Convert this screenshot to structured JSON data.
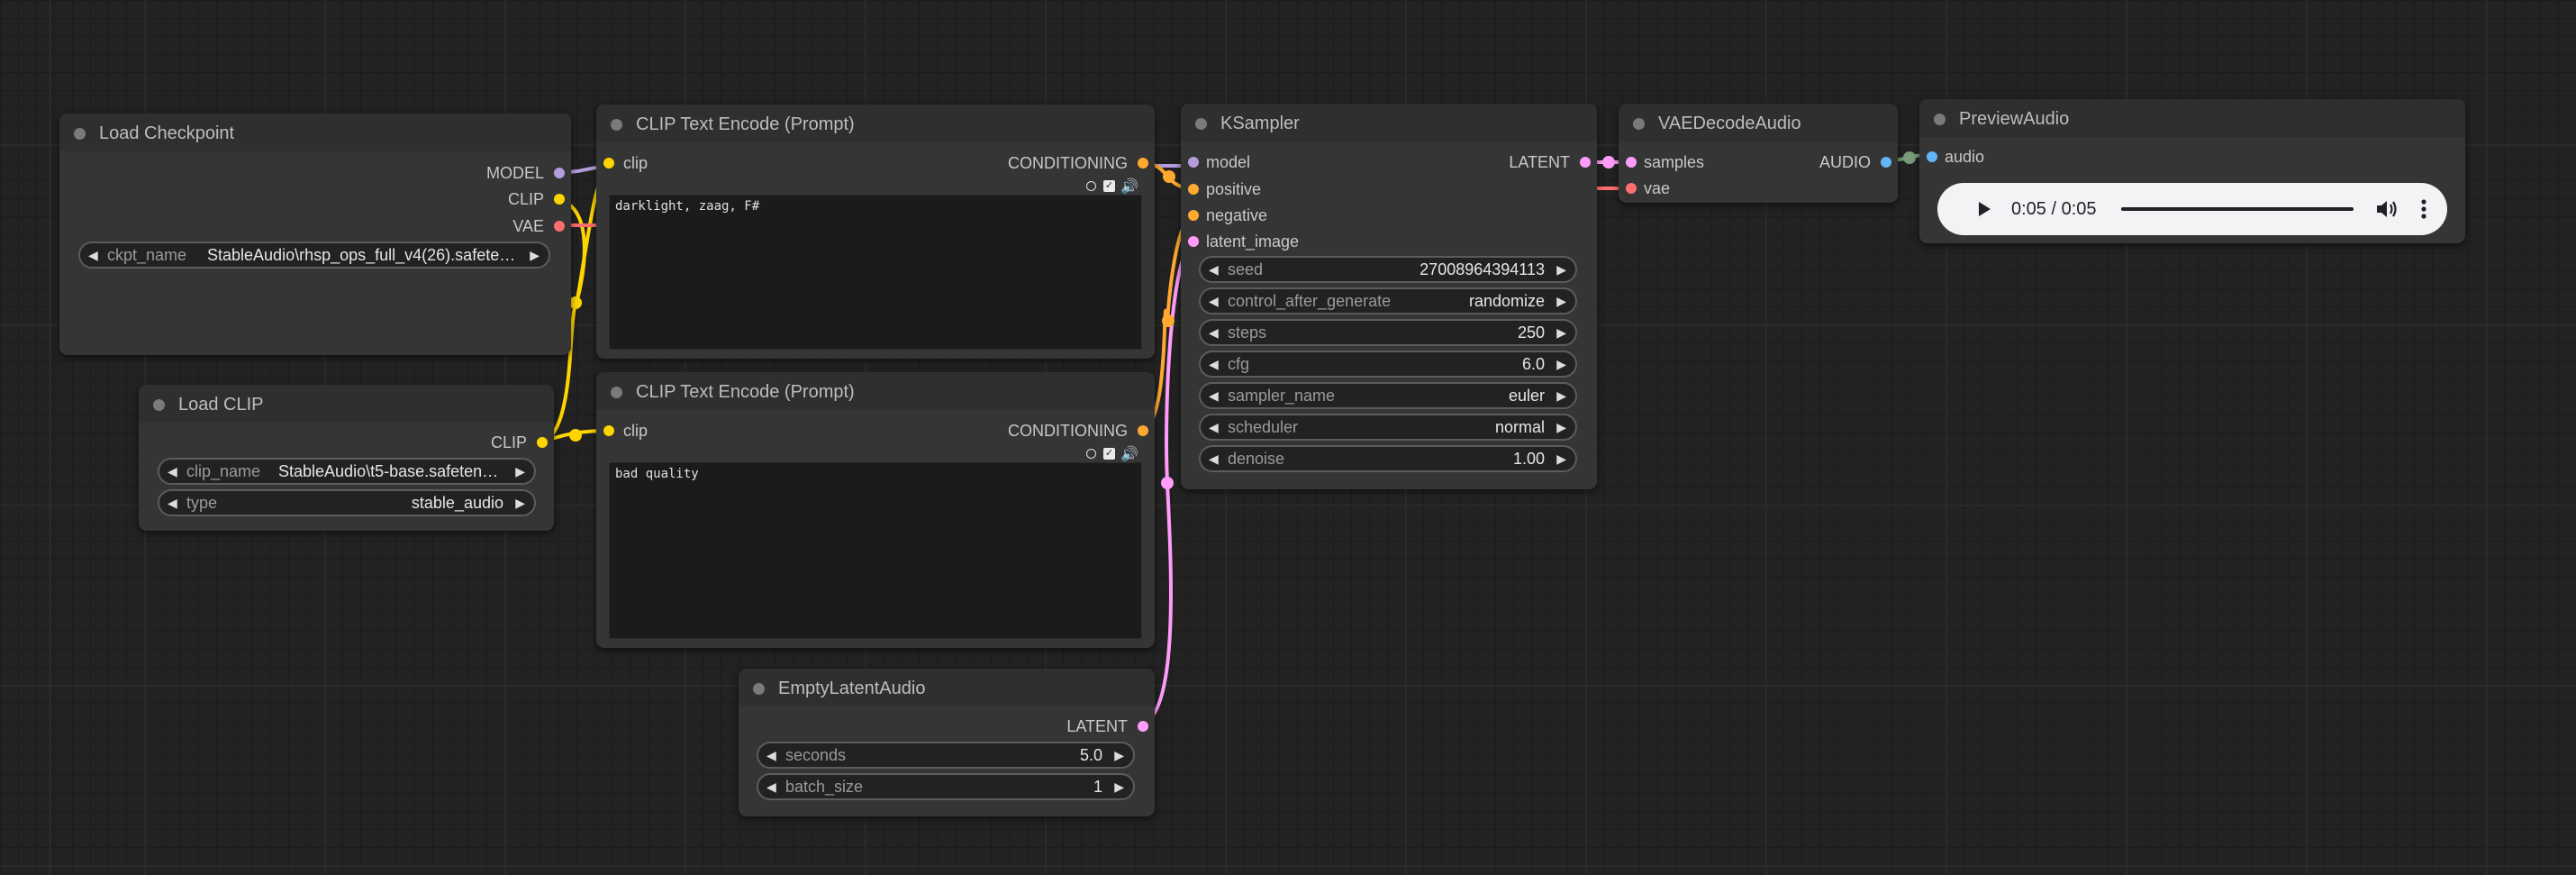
{
  "colors": {
    "model": "#b39ddb",
    "clip": "#ffd500",
    "vae": "#ff6e6e",
    "conditioning": "#ffa931",
    "latent": "#ff9cf9",
    "audio": "#64b5f6"
  },
  "nodes": {
    "load_checkpoint": {
      "title": "Load Checkpoint",
      "outputs": [
        "MODEL",
        "CLIP",
        "VAE"
      ],
      "ckpt_label": "ckpt_name",
      "ckpt_value": "StableAudio\\rhsp_ops_full_v4(26).safeten…"
    },
    "load_clip": {
      "title": "Load CLIP",
      "output": "CLIP",
      "clip_label": "clip_name",
      "clip_value": "StableAudio\\t5-base.safetens…",
      "type_label": "type",
      "type_value": "stable_audio"
    },
    "clip_text_pos": {
      "title": "CLIP Text Encode (Prompt)",
      "input": "clip",
      "output": "CONDITIONING",
      "text": "darklight, zaag, F#"
    },
    "clip_text_neg": {
      "title": "CLIP Text Encode (Prompt)",
      "input": "clip",
      "output": "CONDITIONING",
      "text": "bad quality"
    },
    "ksampler": {
      "title": "KSampler",
      "inputs": [
        "model",
        "positive",
        "negative",
        "latent_image"
      ],
      "output": "LATENT",
      "widgets": [
        {
          "label": "seed",
          "value": "27008964394113"
        },
        {
          "label": "control_after_generate",
          "value": "randomize"
        },
        {
          "label": "steps",
          "value": "250"
        },
        {
          "label": "cfg",
          "value": "6.0"
        },
        {
          "label": "sampler_name",
          "value": "euler"
        },
        {
          "label": "scheduler",
          "value": "normal"
        },
        {
          "label": "denoise",
          "value": "1.00"
        }
      ]
    },
    "vae_decode": {
      "title": "VAEDecodeAudio",
      "inputs": [
        "samples",
        "vae"
      ],
      "output": "AUDIO"
    },
    "preview_audio": {
      "title": "PreviewAudio",
      "input": "audio",
      "player_time": "0:05 / 0:05",
      "progress": 1.0
    },
    "empty_latent": {
      "title": "EmptyLatentAudio",
      "output": "LATENT",
      "widgets": [
        {
          "label": "seconds",
          "value": "5.0"
        },
        {
          "label": "batch_size",
          "value": "1"
        }
      ]
    }
  },
  "icons": {
    "play": "play-icon",
    "volume": "volume-icon",
    "menu": "more-vert-icon",
    "arrow_left": "decrement-arrow-icon",
    "arrow_right": "increment-arrow-icon"
  }
}
